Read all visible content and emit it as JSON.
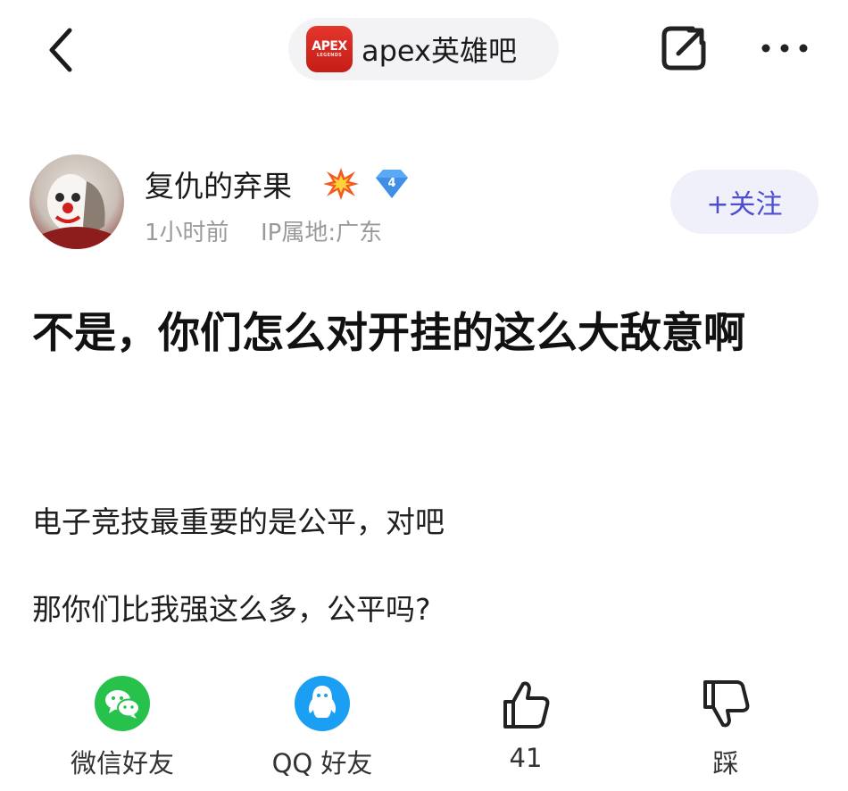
{
  "header": {
    "forum_logo_text": "APEX",
    "forum_logo_subtext": "LEGENDS",
    "forum_name": "apex英雄吧"
  },
  "author": {
    "name": "复仇的弃果",
    "level": "4",
    "time": "1小时前",
    "ip_location": "IP属地:广东",
    "follow_label": "+关注"
  },
  "post": {
    "title": "不是，你们怎么对开挂的这么大敌意啊",
    "paragraphs": [
      "电子竞技最重要的是公平，对吧",
      "那你们比我强这么多，公平吗?"
    ]
  },
  "actions": {
    "wechat_label": "微信好友",
    "qq_label": "QQ 好友",
    "like_count": "41",
    "dislike_label": "踩"
  },
  "colors": {
    "follow_text": "#4b4fcf",
    "follow_bg": "#f0f0fb",
    "wechat": "#27c24c",
    "qq": "#1b9ff4",
    "level_badge": "#5aa9f5"
  }
}
